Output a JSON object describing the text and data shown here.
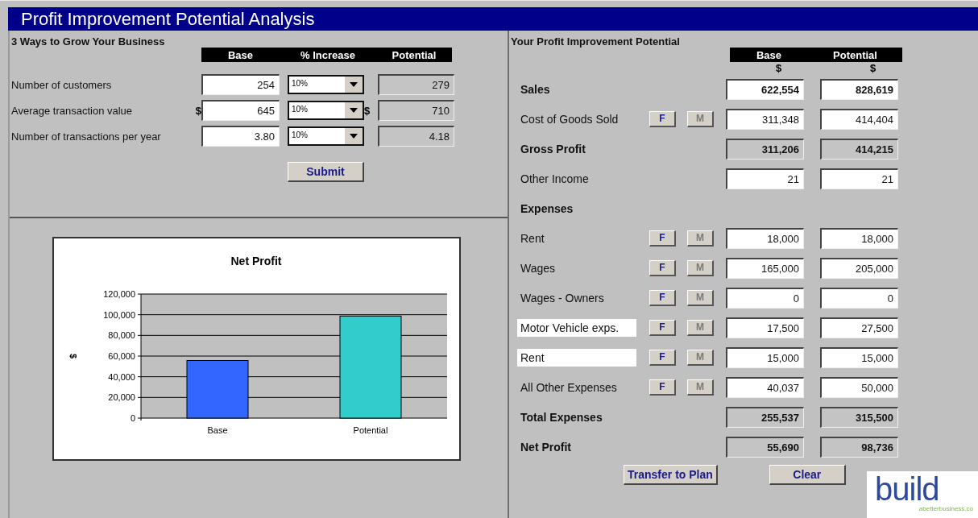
{
  "window": {
    "title": "Profit Improvement Potential Analysis"
  },
  "growth": {
    "heading": "3 Ways to Grow Your Business",
    "columns": [
      "Base",
      "% Increase",
      "Potential"
    ],
    "rows": [
      {
        "label": "Number of customers",
        "base": "254",
        "increase": "10%",
        "potential": "279"
      },
      {
        "label": "Average transaction value",
        "base_prefix": "$",
        "base": "645",
        "increase": "10%",
        "potential_prefix": "$",
        "potential": "710"
      },
      {
        "label": "Number of transactions per year",
        "base": "3.80",
        "increase": "10%",
        "potential": "4.18"
      }
    ],
    "submit": "Submit"
  },
  "chart": {
    "chart_data": {
      "type": "bar",
      "title": "Net Profit",
      "ylabel": "$",
      "categories": [
        "Base",
        "Potential"
      ],
      "series": [
        {
          "color": "#3366ff",
          "values": [
            55700,
            null
          ]
        },
        {
          "color": "#33cccc",
          "values": [
            null,
            98700
          ]
        }
      ],
      "grid": true,
      "ylim": [
        0,
        120000
      ],
      "yticks": [
        {
          "value": 0,
          "label": "0"
        },
        {
          "value": 20000,
          "label": "20,000"
        },
        {
          "value": 40000,
          "label": "40,000"
        },
        {
          "value": 60000,
          "label": "60,000"
        },
        {
          "value": 80000,
          "label": "80,000"
        },
        {
          "value": 100000,
          "label": "100,000"
        },
        {
          "value": 120000,
          "label": "120,000"
        }
      ]
    }
  },
  "potential": {
    "heading": "Your Profit Improvement Potential",
    "columns": [
      "Base",
      "Potential"
    ],
    "units": [
      "$",
      "$"
    ],
    "rows": [
      {
        "kind": "line",
        "label": "Sales",
        "bold": true,
        "editable": true,
        "base": "622,554",
        "potential": "828,619"
      },
      {
        "kind": "line",
        "label": "Cost of Goods Sold",
        "bold": false,
        "editable": true,
        "buttons": [
          {
            "label": "F",
            "disabled": false
          },
          {
            "label": "M",
            "disabled": true
          }
        ],
        "base": "311,348",
        "potential": "414,404"
      },
      {
        "kind": "line",
        "label": "Gross Profit",
        "bold": true,
        "editable": false,
        "base": "311,206",
        "potential": "414,215"
      },
      {
        "kind": "line",
        "label": "Other Income",
        "bold": false,
        "editable": true,
        "base": "21",
        "potential": "21"
      },
      {
        "kind": "section",
        "label": "Expenses"
      },
      {
        "kind": "line",
        "label": "Rent",
        "bold": false,
        "editable": true,
        "buttons": [
          {
            "label": "F",
            "disabled": false
          },
          {
            "label": "M",
            "disabled": true
          }
        ],
        "base": "18,000",
        "potential": "18,000"
      },
      {
        "kind": "line",
        "label": "Wages",
        "bold": false,
        "editable": true,
        "buttons": [
          {
            "label": "F",
            "disabled": false
          },
          {
            "label": "M",
            "disabled": true
          }
        ],
        "base": "165,000",
        "potential": "205,000"
      },
      {
        "kind": "line",
        "label": "Wages - Owners",
        "bold": false,
        "editable": true,
        "buttons": [
          {
            "label": "F",
            "disabled": false
          },
          {
            "label": "M",
            "disabled": true
          }
        ],
        "base": "0",
        "potential": "0"
      },
      {
        "kind": "custom",
        "label": "Motor Vehicle exps.",
        "bold": false,
        "editable": true,
        "buttons": [
          {
            "label": "F",
            "disabled": false
          },
          {
            "label": "M",
            "disabled": true
          }
        ],
        "base": "17,500",
        "potential": "27,500"
      },
      {
        "kind": "custom",
        "label": "Rent",
        "bold": false,
        "editable": true,
        "buttons": [
          {
            "label": "F",
            "disabled": false
          },
          {
            "label": "M",
            "disabled": true
          }
        ],
        "base": "15,000",
        "potential": "15,000"
      },
      {
        "kind": "line",
        "label": "All Other Expenses",
        "bold": false,
        "editable": true,
        "buttons": [
          {
            "label": "F",
            "disabled": false
          },
          {
            "label": "M",
            "disabled": true
          }
        ],
        "base": "40,037",
        "potential": "50,000"
      },
      {
        "kind": "line",
        "label": "Total Expenses",
        "bold": true,
        "editable": false,
        "base": "255,537",
        "potential": "315,500"
      },
      {
        "kind": "line",
        "label": "Net Profit",
        "bold": true,
        "editable": false,
        "base": "55,690",
        "potential": "98,736"
      }
    ],
    "actions": [
      "Transfer to Plan",
      "Clear"
    ]
  },
  "logo": {
    "wordmark": "build",
    "tagline": "abetterbusiness.co"
  }
}
